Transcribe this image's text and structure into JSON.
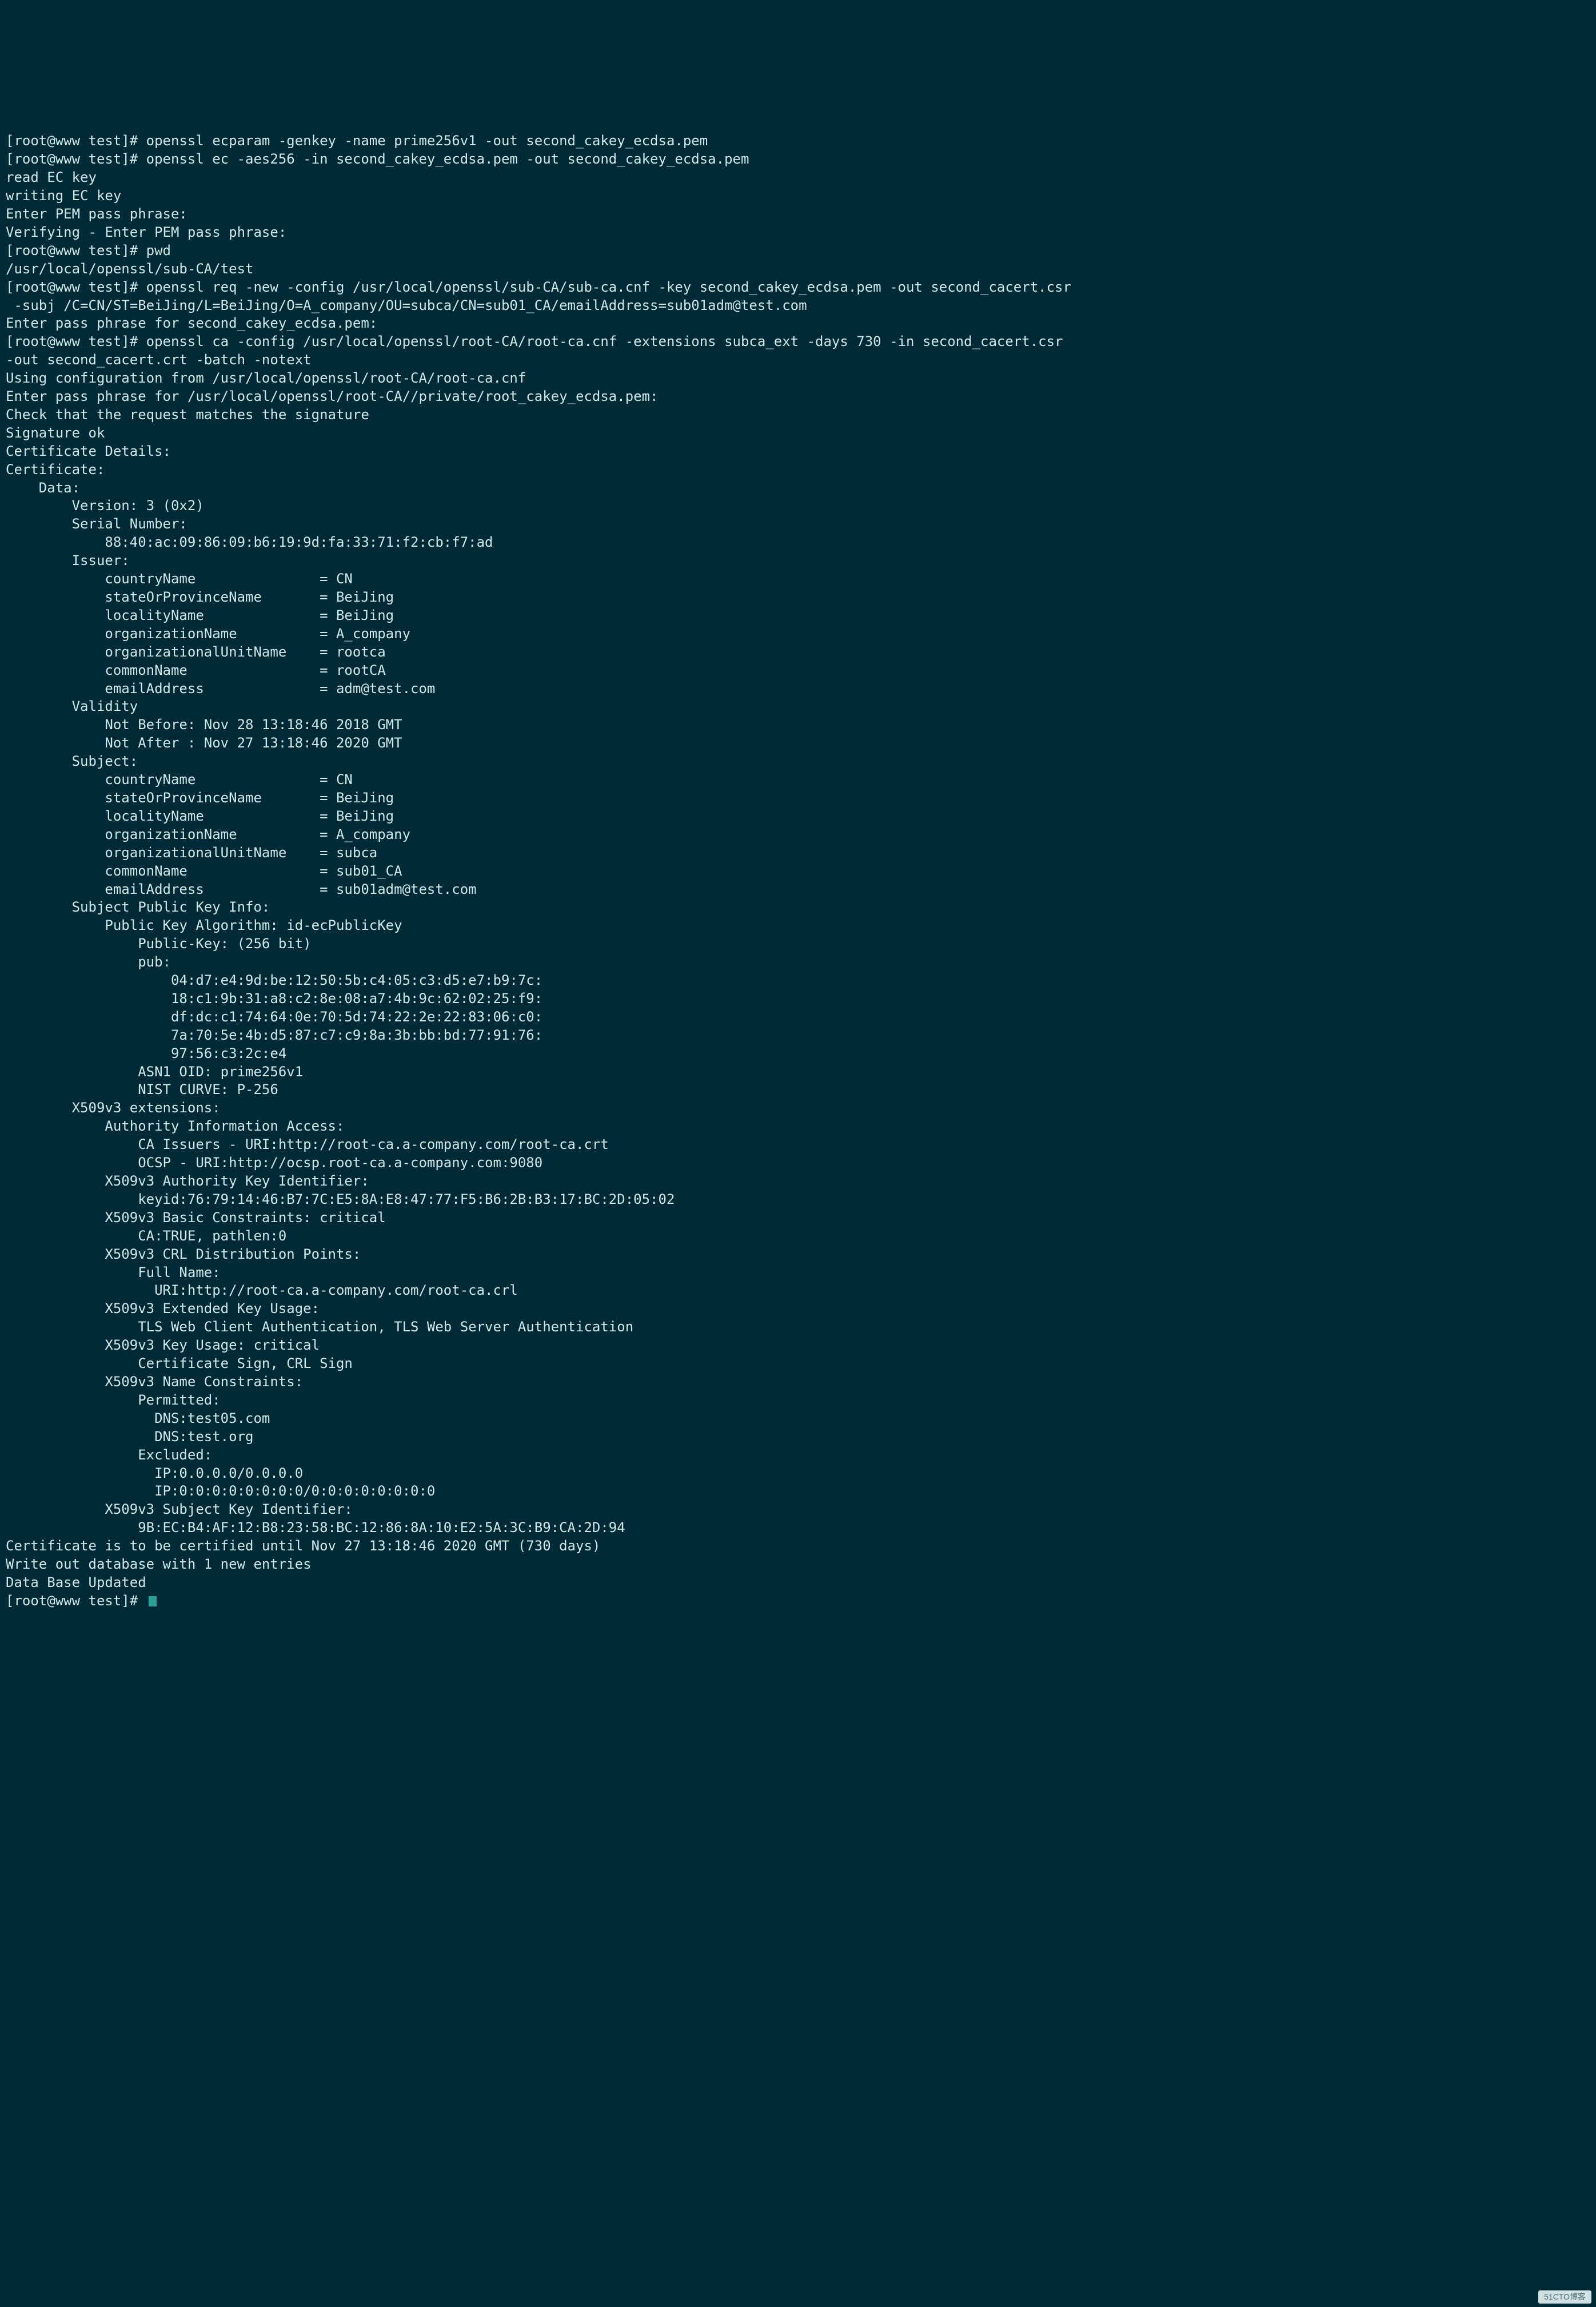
{
  "terminal": {
    "lines": [
      "[root@www test]# openssl ecparam -genkey -name prime256v1 -out second_cakey_ecdsa.pem",
      "[root@www test]# openssl ec -aes256 -in second_cakey_ecdsa.pem -out second_cakey_ecdsa.pem",
      "read EC key",
      "writing EC key",
      "Enter PEM pass phrase:",
      "Verifying - Enter PEM pass phrase:",
      "[root@www test]# pwd",
      "/usr/local/openssl/sub-CA/test",
      "[root@www test]# openssl req -new -config /usr/local/openssl/sub-CA/sub-ca.cnf -key second_cakey_ecdsa.pem -out second_cacert.csr",
      " -subj /C=CN/ST=BeiJing/L=BeiJing/O=A_company/OU=subca/CN=sub01_CA/emailAddress=sub01adm@test.com",
      "Enter pass phrase for second_cakey_ecdsa.pem:",
      "[root@www test]# openssl ca -config /usr/local/openssl/root-CA/root-ca.cnf -extensions subca_ext -days 730 -in second_cacert.csr ",
      "-out second_cacert.crt -batch -notext",
      "Using configuration from /usr/local/openssl/root-CA/root-ca.cnf",
      "Enter pass phrase for /usr/local/openssl/root-CA//private/root_cakey_ecdsa.pem:",
      "Check that the request matches the signature",
      "Signature ok",
      "Certificate Details:",
      "Certificate:",
      "    Data:",
      "        Version: 3 (0x2)",
      "        Serial Number:",
      "            88:40:ac:09:86:09:b6:19:9d:fa:33:71:f2:cb:f7:ad",
      "        Issuer:",
      "            countryName               = CN",
      "            stateOrProvinceName       = BeiJing",
      "            localityName              = BeiJing",
      "            organizationName          = A_company",
      "            organizationalUnitName    = rootca",
      "            commonName                = rootCA",
      "            emailAddress              = adm@test.com",
      "        Validity",
      "            Not Before: Nov 28 13:18:46 2018 GMT",
      "            Not After : Nov 27 13:18:46 2020 GMT",
      "        Subject:",
      "            countryName               = CN",
      "            stateOrProvinceName       = BeiJing",
      "            localityName              = BeiJing",
      "            organizationName          = A_company",
      "            organizationalUnitName    = subca",
      "            commonName                = sub01_CA",
      "            emailAddress              = sub01adm@test.com",
      "        Subject Public Key Info:",
      "            Public Key Algorithm: id-ecPublicKey",
      "                Public-Key: (256 bit)",
      "                pub:",
      "                    04:d7:e4:9d:be:12:50:5b:c4:05:c3:d5:e7:b9:7c:",
      "                    18:c1:9b:31:a8:c2:8e:08:a7:4b:9c:62:02:25:f9:",
      "                    df:dc:c1:74:64:0e:70:5d:74:22:2e:22:83:06:c0:",
      "                    7a:70:5e:4b:d5:87:c7:c9:8a:3b:bb:bd:77:91:76:",
      "                    97:56:c3:2c:e4",
      "                ASN1 OID: prime256v1",
      "                NIST CURVE: P-256",
      "        X509v3 extensions:",
      "            Authority Information Access: ",
      "                CA Issuers - URI:http://root-ca.a-company.com/root-ca.crt",
      "                OCSP - URI:http://ocsp.root-ca.a-company.com:9080",
      "",
      "            X509v3 Authority Key Identifier: ",
      "                keyid:76:79:14:46:B7:7C:E5:8A:E8:47:77:F5:B6:2B:B3:17:BC:2D:05:02",
      "",
      "            X509v3 Basic Constraints: critical",
      "                CA:TRUE, pathlen:0",
      "            X509v3 CRL Distribution Points: ",
      "",
      "                Full Name:",
      "                  URI:http://root-ca.a-company.com/root-ca.crl",
      "",
      "            X509v3 Extended Key Usage: ",
      "                TLS Web Client Authentication, TLS Web Server Authentication",
      "            X509v3 Key Usage: critical",
      "                Certificate Sign, CRL Sign",
      "            X509v3 Name Constraints: ",
      "                Permitted:",
      "                  DNS:test05.com",
      "                  DNS:test.org",
      "                Excluded:",
      "                  IP:0.0.0.0/0.0.0.0",
      "                  IP:0:0:0:0:0:0:0:0/0:0:0:0:0:0:0:0",
      "",
      "            X509v3 Subject Key Identifier: ",
      "                9B:EC:B4:AF:12:B8:23:58:BC:12:86:8A:10:E2:5A:3C:B9:CA:2D:94",
      "Certificate is to be certified until Nov 27 13:18:46 2020 GMT (730 days)",
      "",
      "Write out database with 1 new entries",
      "Data Base Updated",
      "[root@www test]# "
    ]
  },
  "watermark": "51CTO博客"
}
